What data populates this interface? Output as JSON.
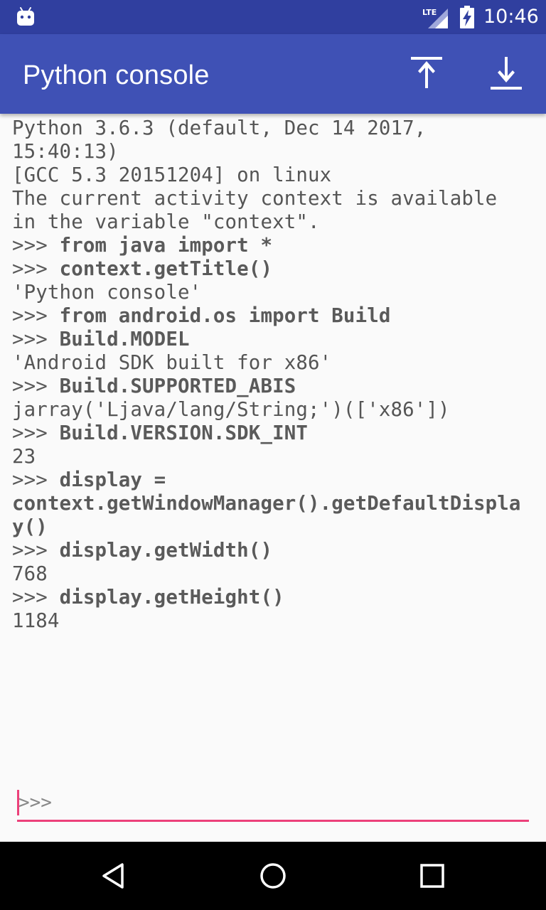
{
  "status_bar": {
    "network": "LTE",
    "time": "10:46"
  },
  "app_bar": {
    "title": "Python console",
    "actions": [
      {
        "icon": "scroll-to-top-icon"
      },
      {
        "icon": "scroll-to-bottom-icon"
      }
    ]
  },
  "console": {
    "lines": [
      {
        "type": "output",
        "text": "Python 3.6.3 (default, Dec 14 2017,"
      },
      {
        "type": "output",
        "text": "15:40:13)"
      },
      {
        "type": "output",
        "text": "[GCC 5.3 20151204] on linux"
      },
      {
        "type": "output",
        "text": "The current activity context is available"
      },
      {
        "type": "output",
        "text": "in the variable \"context\"."
      },
      {
        "type": "input",
        "prompt": ">>> ",
        "text": "from java import *"
      },
      {
        "type": "input",
        "prompt": ">>> ",
        "text": "context.getTitle()"
      },
      {
        "type": "output",
        "text": "'Python console'"
      },
      {
        "type": "input",
        "prompt": ">>> ",
        "text": "from android.os import Build"
      },
      {
        "type": "input",
        "prompt": ">>> ",
        "text": "Build.MODEL"
      },
      {
        "type": "output",
        "text": "'Android SDK built for x86'"
      },
      {
        "type": "input",
        "prompt": ">>> ",
        "text": "Build.SUPPORTED_ABIS"
      },
      {
        "type": "output",
        "text": "jarray('Ljava/lang/String;')(['x86'])"
      },
      {
        "type": "input",
        "prompt": ">>> ",
        "text": "Build.VERSION.SDK_INT"
      },
      {
        "type": "output",
        "text": "23"
      },
      {
        "type": "input",
        "prompt": ">>> ",
        "text": "display ="
      },
      {
        "type": "input",
        "prompt": "",
        "text": "context.getWindowManager().getDefaultDispla"
      },
      {
        "type": "input",
        "prompt": "",
        "text": "y()"
      },
      {
        "type": "input",
        "prompt": ">>> ",
        "text": "display.getWidth()"
      },
      {
        "type": "output",
        "text": "768"
      },
      {
        "type": "input",
        "prompt": ">>> ",
        "text": "display.getHeight()"
      },
      {
        "type": "output",
        "text": "1184"
      }
    ]
  },
  "input": {
    "prompt": ">>>",
    "value": "",
    "accent_color": "#ec407a"
  },
  "nav_bar": {
    "buttons": [
      "back-icon",
      "home-icon",
      "recents-icon"
    ]
  },
  "colors": {
    "status_bar": "#303f9f",
    "app_bar": "#3f51b5",
    "background": "#fafafa",
    "accent": "#ec407a"
  }
}
